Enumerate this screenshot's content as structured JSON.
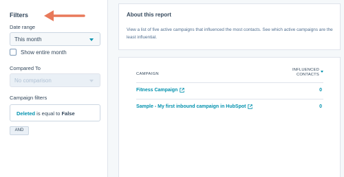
{
  "sidebar": {
    "title": "Filters",
    "date_range_label": "Date range",
    "date_range_value": "This month",
    "show_entire_month_label": "Show entire month",
    "compared_to_label": "Compared To",
    "compared_to_placeholder": "No comparison",
    "campaign_filters_label": "Campaign filters",
    "filter": {
      "property": "Deleted",
      "operator": " is equal to ",
      "value": "False"
    },
    "and_button": "AND"
  },
  "about": {
    "title": "About this report",
    "description": "View a list of five active campaigns that influenced the most contacts. See which active campaigns are the least influential."
  },
  "table": {
    "columns": {
      "campaign": "CAMPAIGN",
      "influenced_line1": "INFLUENCED",
      "influenced_line2": "CONTACTS"
    },
    "rows": [
      {
        "name": "Fitness Campaign",
        "value": "0"
      },
      {
        "name": "Sample - My first inbound campaign in HubSpot",
        "value": "0"
      }
    ]
  },
  "colors": {
    "accent": "#0091ae",
    "arrow": "#e8795a",
    "text": "#33475b"
  },
  "icons": {
    "annotation": "arrow-left-icon",
    "external": "external-link-icon",
    "sort": "sort-down-icon",
    "dropdown": "chevron-down-icon"
  }
}
